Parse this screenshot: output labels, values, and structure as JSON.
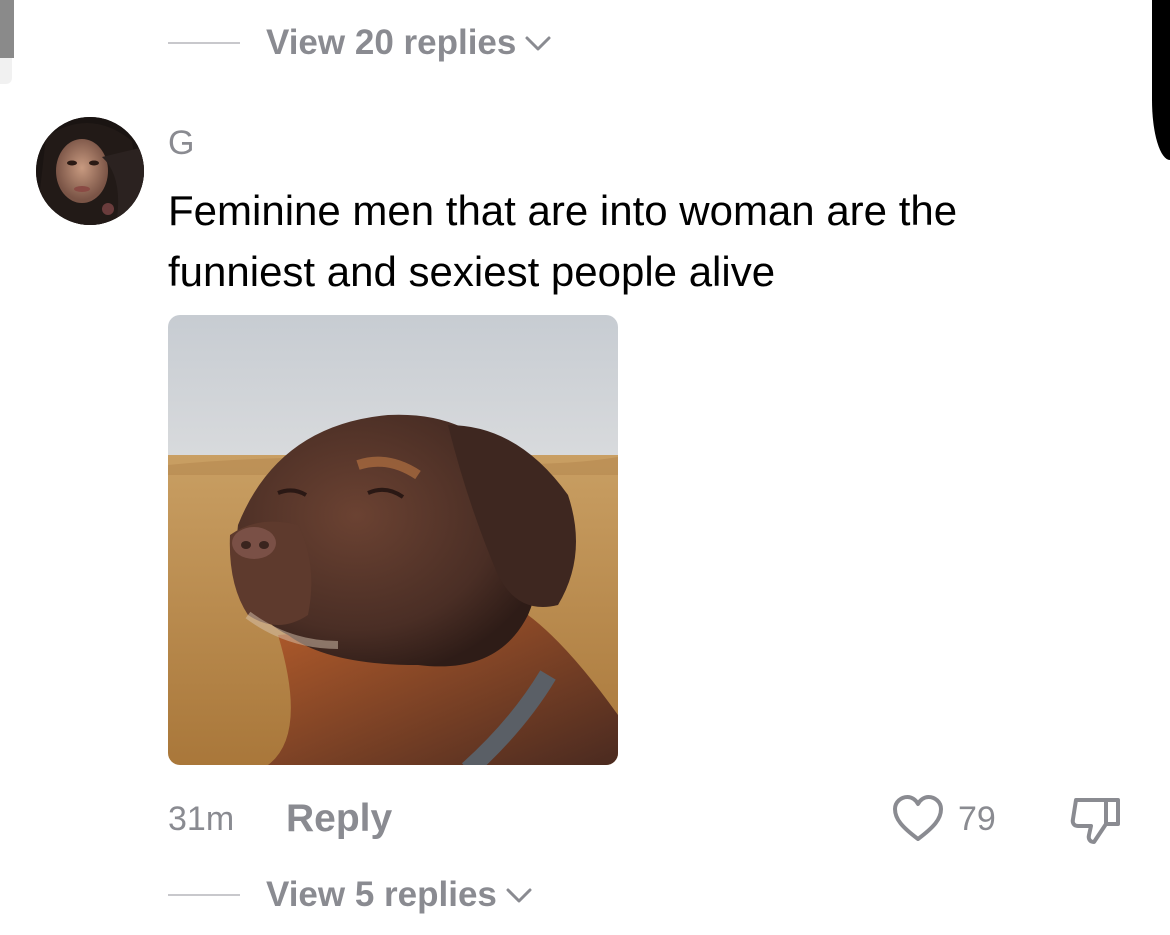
{
  "thread_top": {
    "view_replies_label": "View 20 replies"
  },
  "comment": {
    "username": "G",
    "text": "Feminine men that are into woman are the funniest and sexiest people alive",
    "timestamp": "31m",
    "reply_label": "Reply",
    "like_count": "79"
  },
  "thread_bottom": {
    "view_replies_label": "View 5 replies"
  },
  "colors": {
    "muted_text": "#8a8b91",
    "primary_text": "#000000",
    "divider": "#c8c8cc"
  },
  "icons": {
    "view_more": "chevron-down-icon",
    "like": "heart-outline-icon",
    "dislike": "thumbs-down-icon"
  }
}
